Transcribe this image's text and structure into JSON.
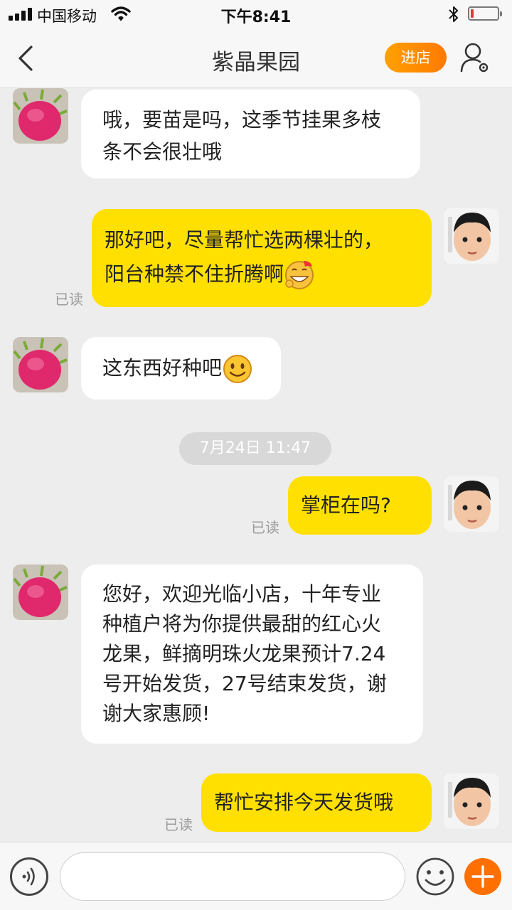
{
  "status_bar": {
    "carrier": "中国移动",
    "time": "下午8:41",
    "battery_level": 0.12
  },
  "header": {
    "title": "紫晶果园",
    "shop_button": "进店"
  },
  "messages": [
    {
      "side": "in",
      "text_lines": [
        "哦，要苗是吗，这季节挂果多枝",
        "条不会很壮哦"
      ]
    },
    {
      "side": "out",
      "text_lines": [
        "那好吧，尽量帮忙选两棵壮的，",
        "阳台种禁不住折腾啊"
      ],
      "emoji": "grinning-face-emoji",
      "status": "已读"
    },
    {
      "side": "in",
      "text_lines": [
        "这东西好种吧"
      ],
      "emoji": "smile-emoji"
    },
    {
      "side": "out",
      "text_lines": [
        "掌柜在吗?"
      ],
      "status": "已读"
    },
    {
      "side": "in",
      "text_lines": [
        "您好，欢迎光临小店，十年专业",
        "种植户将为你提供最甜的红心火",
        "龙果，鲜摘明珠火龙果预计7.24",
        "号开始发货，27号结束发货，谢",
        "谢大家惠顾!"
      ]
    },
    {
      "side": "out",
      "text_lines": [
        "帮忙安排今天发货哦"
      ],
      "status": "已读"
    }
  ],
  "timestamp_divider": "7月24日 11:47",
  "input": {
    "value": "",
    "placeholder": ""
  },
  "colors": {
    "accent": "#ff7a00",
    "out_bubble": "#ffe000",
    "in_bubble": "#ffffff",
    "background": "#ededed"
  }
}
